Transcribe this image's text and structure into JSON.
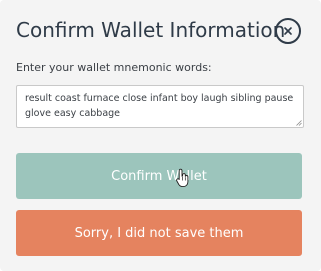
{
  "dialog": {
    "title": "Confirm Wallet Information",
    "close_icon": "close-icon"
  },
  "form": {
    "label": "Enter your wallet mnemonic words:",
    "mnemonic_value": "result coast furnace close infant boy laugh sibling pause glove easy cabbage"
  },
  "buttons": {
    "confirm_label": "Confirm Wallet",
    "sorry_label": "Sorry, I did not save them"
  },
  "colors": {
    "confirm_bg": "#9cc5bc",
    "sorry_bg": "#e5835f",
    "text_dark": "#2f3b48"
  },
  "cursor": {
    "icon": "hand-pointer-icon"
  }
}
